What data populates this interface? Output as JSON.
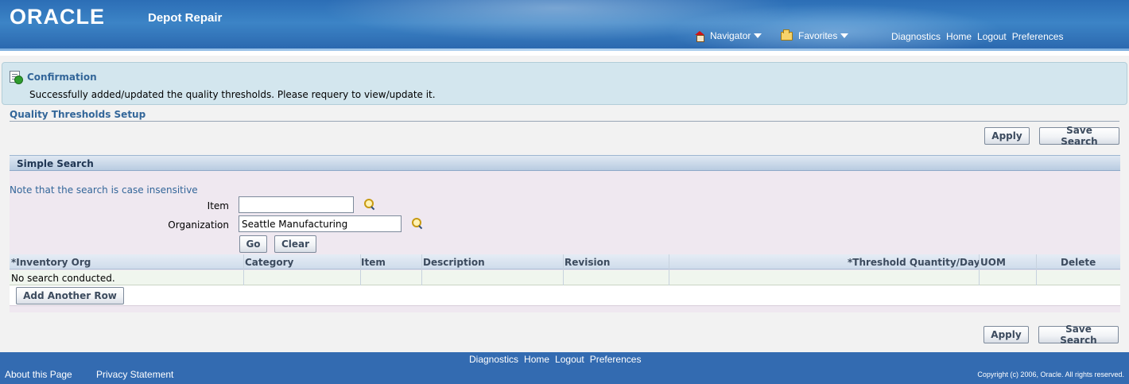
{
  "header": {
    "logo": "ORACLE",
    "product": "Depot Repair",
    "navigator": "Navigator",
    "favorites": "Favorites",
    "links": [
      "Diagnostics",
      "Home",
      "Logout",
      "Preferences"
    ]
  },
  "confirmation": {
    "title": "Confirmation",
    "message": "Successfully added/updated the quality thresholds. Please requery to view/update it."
  },
  "page": {
    "title": "Quality Thresholds Setup",
    "apply": "Apply",
    "save_search": "Save Search"
  },
  "search": {
    "header": "Simple Search",
    "note": "Note that the search is case insensitive",
    "item_label": "Item",
    "item_value": "",
    "org_label": "Organization",
    "org_value": "Seattle Manufacturing",
    "go": "Go",
    "clear": "Clear"
  },
  "table": {
    "columns": [
      "*Inventory Org",
      "Category",
      "Item",
      "Description",
      "Revision",
      "*Threshold Quantity/Day",
      "UOM",
      "Delete"
    ],
    "empty_message": "No search conducted.",
    "add_row": "Add Another Row"
  },
  "footer": {
    "links": [
      "Diagnostics",
      "Home",
      "Logout",
      "Preferences"
    ],
    "about": "About this Page",
    "privacy": "Privacy Statement",
    "copyright": "Copyright (c) 2006, Oracle. All rights reserved."
  },
  "colors": {
    "banner": "#2c6eb6",
    "accent_text": "#336699",
    "footer": "#336bb1",
    "confirm_bg": "#d3e6ee",
    "region_bg": "#efe8f0"
  }
}
